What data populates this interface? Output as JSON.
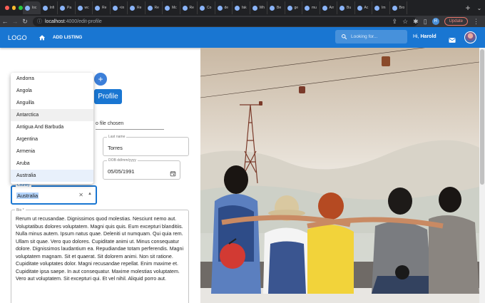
{
  "browser": {
    "tabs": [
      "loc",
      "Infi",
      "Pa",
      "wc",
      "Re",
      "<in",
      "Re",
      "Re",
      "Mc",
      "Re",
      "Co",
      "de",
      "fak",
      "Wh",
      "Be",
      "ge",
      "mu",
      "Arr",
      "Bu",
      "Ac",
      "Im",
      "Bro"
    ],
    "url_host": "localhost",
    "url_path": ":4000/edit-profile",
    "profile_initial": "H",
    "update_label": "Update"
  },
  "appbar": {
    "logo": "LOGO",
    "add_listing": "ADD LISTING",
    "search_placeholder": "Looking for...",
    "greeting_prefix": "Hi, ",
    "user_name": "Harold"
  },
  "form": {
    "profile_button": "Profile",
    "file_text": "o file chosen",
    "last_name_label": "Last name",
    "last_name_value": "Torres",
    "dob_label": "DOB dd/mm/yyyy",
    "dob_value": "05/05/1991",
    "country_label": "Country",
    "country_value": "Australia",
    "bio_label": "Bio *",
    "bio_text": "Rerum ut recusandae. Dignissimos quod molestias. Nesciunt nemo aut. Voluptatibus dolores voluptatem. Magni quis quis. Eum excepturi blanditiis. Nulla minus autem. Ipsum natus quae. Deleniti ut numquam. Qui quia rem. Ullam sit quae. Vero quo dolores. Cupiditate animi ut. Minus consequatur dolore. Dignissimos laudantium ea. Repudiandae totam perferendis. Magni voluptatem magnam. Sit et quaerat. Sit dolorem animi. Non sit ratione. Cupiditate voluptates dolor. Magni recusandae repellat. Enim maxime et. Cupiditate ipsa saepe. In aut consequatur. Maxime molestias voluptatem. Vero aut voluptatem. Sit excepturi qui. Et vel nihil. Aliquid porro aut."
  },
  "country_options": [
    "Andorra",
    "Angola",
    "Anguilla",
    "Antarctica",
    "Antigua And Barbuda",
    "Argentina",
    "Armenia",
    "Aruba",
    "Australia"
  ],
  "colors": {
    "appbar": "#1976d2",
    "primary": "#1976d2"
  }
}
